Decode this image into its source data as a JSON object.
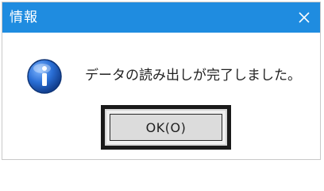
{
  "dialog": {
    "title": "情報",
    "message": "データの読み出しが完了しました。",
    "ok_label": "OK(O)",
    "icon": "information-icon",
    "close_icon": "close-icon"
  },
  "colors": {
    "titlebar": "#1f8ce0",
    "title_text": "#ffffff",
    "icon_blue": "#1c5fbf",
    "button_frame": "#1a1a1a",
    "button_face": "#dcdcdc"
  }
}
